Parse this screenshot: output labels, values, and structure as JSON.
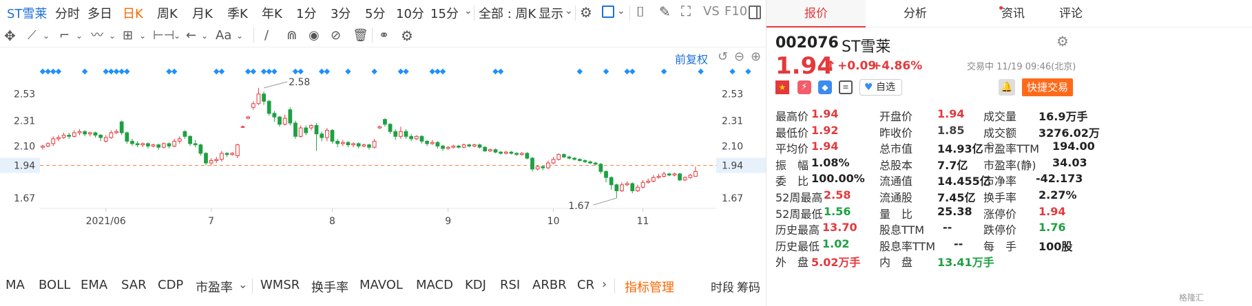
{
  "toolbar": {
    "stock_name": "ST雪莱",
    "periods": [
      "分时",
      "多日",
      "日K",
      "周K",
      "月K",
      "季K",
      "年K",
      "1分",
      "3分",
      "5分",
      "10分",
      "15分"
    ],
    "active_period": "日K",
    "all_select": "全部 : 周K",
    "display_select": "显示",
    "vs_label": "VS",
    "f10_label": "F10"
  },
  "drawing_tools": [
    "move-icon",
    "line-icon",
    "polyline-icon",
    "wave-icon",
    "fib-icon",
    "range-icon",
    "arrow-icon",
    "text-icon",
    "pen-icon",
    "magnet-icon",
    "eye-icon",
    "hide-icon",
    "trash-icon",
    "link-icon",
    "gear-icon"
  ],
  "chart_header": {
    "adjust_label": "前复权"
  },
  "chart_data": {
    "type": "candlestick",
    "y_ticks": [
      2.53,
      2.31,
      2.1,
      1.94,
      1.67
    ],
    "y_tick_labels": [
      "2.53",
      "2.31",
      "2.10",
      "1.94",
      "1.67"
    ],
    "current_price_label": "1.94",
    "ylim": [
      1.5,
      2.75
    ],
    "x_tick_labels": [
      {
        "label": "2021/06",
        "at": 12
      },
      {
        "label": "7",
        "at": 32
      },
      {
        "label": "8",
        "at": 55
      },
      {
        "label": "9",
        "at": 77
      },
      {
        "label": "10",
        "at": 97
      },
      {
        "label": "11",
        "at": 114
      }
    ],
    "annotations": [
      {
        "label": "2.58",
        "at": 42,
        "value": 2.58
      },
      {
        "label": "1.67",
        "at": 109,
        "value": 1.67
      }
    ],
    "reference_line": 1.94,
    "marker_color": "#1e90ff",
    "up_color": "#e4393c",
    "down_color": "#1ea042",
    "candles": [
      [
        2.09,
        2.1,
        2.11,
        2.07
      ],
      [
        2.1,
        2.12,
        2.13,
        2.09
      ],
      [
        2.12,
        2.16,
        2.18,
        2.1
      ],
      [
        2.16,
        2.17,
        2.19,
        2.14
      ],
      [
        2.17,
        2.19,
        2.21,
        2.16
      ],
      [
        2.19,
        2.18,
        2.21,
        2.16
      ],
      [
        2.18,
        2.21,
        2.23,
        2.17
      ],
      [
        2.21,
        2.22,
        2.24,
        2.19
      ],
      [
        2.22,
        2.2,
        2.23,
        2.18
      ],
      [
        2.2,
        2.21,
        2.22,
        2.18
      ],
      [
        2.21,
        2.19,
        2.22,
        2.17
      ],
      [
        2.19,
        2.17,
        2.2,
        2.14
      ],
      [
        2.14,
        2.17,
        2.19,
        2.13
      ],
      [
        2.17,
        2.21,
        2.23,
        2.16
      ],
      [
        2.21,
        2.22,
        2.24,
        2.2
      ],
      [
        2.3,
        2.21,
        2.31,
        2.19
      ],
      [
        2.21,
        2.14,
        2.22,
        2.12
      ],
      [
        2.14,
        2.12,
        2.16,
        2.1
      ],
      [
        2.12,
        2.11,
        2.14,
        2.09
      ],
      [
        2.11,
        2.12,
        2.13,
        2.09
      ],
      [
        2.12,
        2.1,
        2.13,
        2.08
      ],
      [
        2.1,
        2.11,
        2.12,
        2.09
      ],
      [
        2.11,
        2.09,
        2.12,
        2.07
      ],
      [
        2.09,
        2.12,
        2.13,
        2.08
      ],
      [
        2.12,
        2.1,
        2.13,
        2.08
      ],
      [
        2.1,
        2.14,
        2.16,
        2.09
      ],
      [
        2.14,
        2.16,
        2.18,
        2.12
      ],
      [
        2.22,
        2.18,
        2.23,
        2.16
      ],
      [
        2.18,
        2.12,
        2.19,
        2.1
      ],
      [
        2.12,
        2.11,
        2.15,
        2.09
      ],
      [
        2.11,
        2.04,
        2.12,
        2.02
      ],
      [
        2.04,
        1.96,
        2.05,
        1.94
      ],
      [
        1.96,
        1.98,
        2.0,
        1.94
      ],
      [
        1.98,
        1.99,
        2.01,
        1.96
      ],
      [
        1.99,
        2.04,
        2.06,
        1.97
      ],
      [
        2.04,
        2.03,
        2.05,
        2.01
      ],
      [
        2.03,
        2.04,
        2.05,
        2.02
      ],
      [
        2.02,
        2.11,
        2.12,
        2.0
      ],
      [
        2.26,
        2.26,
        2.27,
        2.25
      ],
      [
        2.33,
        2.34,
        2.35,
        2.32
      ],
      [
        2.42,
        2.45,
        2.47,
        2.4
      ],
      [
        2.45,
        2.53,
        2.58,
        2.44
      ],
      [
        2.53,
        2.47,
        2.55,
        2.44
      ],
      [
        2.47,
        2.37,
        2.48,
        2.35
      ],
      [
        2.37,
        2.34,
        2.39,
        2.3
      ],
      [
        2.34,
        2.28,
        2.35,
        2.26
      ],
      [
        2.28,
        2.33,
        2.36,
        2.27
      ],
      [
        2.4,
        2.29,
        2.42,
        2.27
      ],
      [
        2.29,
        2.18,
        2.31,
        2.16
      ],
      [
        2.18,
        2.25,
        2.27,
        2.17
      ],
      [
        2.25,
        2.21,
        2.27,
        2.19
      ],
      [
        2.25,
        2.27,
        2.28,
        2.23
      ],
      [
        2.27,
        2.2,
        2.29,
        2.06
      ],
      [
        2.2,
        2.17,
        2.22,
        2.14
      ],
      [
        2.17,
        2.23,
        2.25,
        2.14
      ],
      [
        2.23,
        2.14,
        2.24,
        2.12
      ],
      [
        2.14,
        2.12,
        2.16,
        2.09
      ],
      [
        2.12,
        2.13,
        2.15,
        2.1
      ],
      [
        2.13,
        2.11,
        2.14,
        2.09
      ],
      [
        2.11,
        2.12,
        2.13,
        2.09
      ],
      [
        2.12,
        2.1,
        2.13,
        2.08
      ],
      [
        2.1,
        2.11,
        2.12,
        2.09
      ],
      [
        2.11,
        2.09,
        2.12,
        2.07
      ],
      [
        2.09,
        2.14,
        2.16,
        2.08
      ],
      [
        2.25,
        2.26,
        2.27,
        2.24
      ],
      [
        2.32,
        2.28,
        2.33,
        2.26
      ],
      [
        2.28,
        2.22,
        2.29,
        2.2
      ],
      [
        2.22,
        2.18,
        2.24,
        2.15
      ],
      [
        2.18,
        2.22,
        2.26,
        2.16
      ],
      [
        2.22,
        2.18,
        2.24,
        2.16
      ],
      [
        2.18,
        2.16,
        2.2,
        2.14
      ],
      [
        2.16,
        2.18,
        2.19,
        2.15
      ],
      [
        2.18,
        2.14,
        2.19,
        2.12
      ],
      [
        2.14,
        2.12,
        2.15,
        2.1
      ],
      [
        2.12,
        2.13,
        2.15,
        2.11
      ],
      [
        2.13,
        2.1,
        2.14,
        2.08
      ],
      [
        2.1,
        2.08,
        2.11,
        2.06
      ],
      [
        2.08,
        2.09,
        2.1,
        2.07
      ],
      [
        2.09,
        2.1,
        2.11,
        2.08
      ],
      [
        2.1,
        2.09,
        2.11,
        2.08
      ],
      [
        2.09,
        2.11,
        2.12,
        2.08
      ],
      [
        2.11,
        2.1,
        2.12,
        2.09
      ],
      [
        2.1,
        2.11,
        2.12,
        2.09
      ],
      [
        2.11,
        2.09,
        2.12,
        2.08
      ],
      [
        2.09,
        2.06,
        2.1,
        2.05
      ],
      [
        2.06,
        2.07,
        2.08,
        2.05
      ],
      [
        2.07,
        2.05,
        2.08,
        2.04
      ],
      [
        2.05,
        2.04,
        2.06,
        2.03
      ],
      [
        2.04,
        2.05,
        2.06,
        2.03
      ],
      [
        2.05,
        2.04,
        2.06,
        2.03
      ],
      [
        2.04,
        2.03,
        2.05,
        2.02
      ],
      [
        2.03,
        2.04,
        2.05,
        2.02
      ],
      [
        2.04,
        2.0,
        2.05,
        1.99
      ],
      [
        2.0,
        1.91,
        2.01,
        1.89
      ],
      [
        1.91,
        1.93,
        1.94,
        1.9
      ],
      [
        1.93,
        1.92,
        1.94,
        1.9
      ],
      [
        1.92,
        1.96,
        1.98,
        1.91
      ],
      [
        1.96,
        1.99,
        2.01,
        1.95
      ],
      [
        1.99,
        2.03,
        2.04,
        1.98
      ],
      [
        2.03,
        2.01,
        2.04,
        2.0
      ],
      [
        2.01,
        2.0,
        2.02,
        1.99
      ],
      [
        2.0,
        1.99,
        2.01,
        1.98
      ],
      [
        1.99,
        1.98,
        2.0,
        1.97
      ],
      [
        1.98,
        1.97,
        1.99,
        1.96
      ],
      [
        1.97,
        1.96,
        1.98,
        1.95
      ],
      [
        1.96,
        1.95,
        1.97,
        1.94
      ],
      [
        1.95,
        1.89,
        1.96,
        1.87
      ],
      [
        1.89,
        1.84,
        1.9,
        1.8
      ],
      [
        1.84,
        1.78,
        1.85,
        1.74
      ],
      [
        1.78,
        1.73,
        1.79,
        1.67
      ],
      [
        1.73,
        1.78,
        1.8,
        1.72
      ],
      [
        1.78,
        1.79,
        1.81,
        1.77
      ],
      [
        1.79,
        1.73,
        1.8,
        1.71
      ],
      [
        1.73,
        1.76,
        1.78,
        1.72
      ],
      [
        1.76,
        1.8,
        1.82,
        1.75
      ],
      [
        1.8,
        1.81,
        1.83,
        1.79
      ],
      [
        1.81,
        1.84,
        1.86,
        1.8
      ],
      [
        1.84,
        1.85,
        1.87,
        1.83
      ],
      [
        1.85,
        1.87,
        1.89,
        1.84
      ],
      [
        1.87,
        1.86,
        1.88,
        1.85
      ],
      [
        1.86,
        1.87,
        1.88,
        1.85
      ],
      [
        1.87,
        1.82,
        1.88,
        1.81
      ],
      [
        1.82,
        1.84,
        1.85,
        1.81
      ],
      [
        1.84,
        1.86,
        1.87,
        1.83
      ],
      [
        1.85,
        1.89,
        1.93,
        1.85
      ]
    ],
    "marker_groups": [
      [
        0,
        1,
        2,
        3
      ],
      [
        8
      ],
      [
        12,
        13,
        14,
        15,
        16
      ],
      [
        24,
        25
      ],
      [
        33,
        34
      ],
      [
        39,
        40
      ],
      [
        42,
        43,
        44
      ],
      [
        48,
        49
      ],
      [
        53,
        54
      ],
      [
        58
      ],
      [
        63
      ],
      [
        68,
        69
      ],
      [
        74,
        75,
        76
      ],
      [
        86,
        87
      ],
      [
        102
      ],
      [
        107
      ],
      [
        111,
        112
      ],
      [
        118
      ],
      [
        125
      ],
      [
        131
      ],
      [
        134
      ],
      [
        140,
        141,
        142
      ]
    ]
  },
  "indicators": [
    "MA",
    "BOLL",
    "EMA",
    "SAR",
    "CDP",
    "市盈率",
    "WMSR",
    "换手率",
    "MAVOL",
    "MACD",
    "KDJ",
    "RSI",
    "ARBR",
    "CR"
  ],
  "indicator_manage": "指标管理",
  "bottom_right": [
    "时段",
    "筹码"
  ],
  "right_tabs": [
    "报价",
    "分析",
    "资讯",
    "评论"
  ],
  "active_tab": "报价",
  "quote": {
    "code": "002076",
    "name": "ST雪莱",
    "price": "1.94",
    "change": "+0.09",
    "change_pct": "+4.86%",
    "status_time": "交易中 11/19 09:46(北京)",
    "watch_label": "自选",
    "quick_trade": "快捷交易"
  },
  "fields": [
    {
      "k": "最高价",
      "v": "1.94",
      "c": "red"
    },
    {
      "k": "开盘价",
      "v": "1.94",
      "c": "red"
    },
    {
      "k": "成交量",
      "v": "16.9万手",
      "c": "dark"
    },
    {
      "k": "最低价",
      "v": "1.92",
      "c": "red"
    },
    {
      "k": "昨收价",
      "v": "1.85",
      "c": "gray"
    },
    {
      "k": "成交额",
      "v": "3276.02万",
      "c": "dark"
    },
    {
      "k": "平均价",
      "v": "1.94",
      "c": "red"
    },
    {
      "k": "总市值",
      "v": "14.93亿",
      "c": "dark"
    },
    {
      "k": "市盈率TTM",
      "v": "194.00",
      "c": "dark"
    },
    {
      "k": "振　幅",
      "v": "1.08%",
      "c": "dark"
    },
    {
      "k": "总股本",
      "v": "7.7亿",
      "c": "dark"
    },
    {
      "k": "市盈率(静)",
      "v": "34.03",
      "c": "dark"
    },
    {
      "k": "委　比",
      "v": "100.00%",
      "c": "dark"
    },
    {
      "k": "流通值",
      "v": "14.455亿",
      "c": "dark"
    },
    {
      "k": "市净率",
      "v": "-42.173",
      "c": "dark"
    },
    {
      "k": "52周最高",
      "v": "2.58",
      "c": "red"
    },
    {
      "k": "流通股",
      "v": "7.45亿",
      "c": "dark"
    },
    {
      "k": "换手率",
      "v": "2.27%",
      "c": "dark"
    },
    {
      "k": "52周最低",
      "v": "1.56",
      "c": "green"
    },
    {
      "k": "量　比",
      "v": "25.38",
      "c": "dark"
    },
    {
      "k": "涨停价",
      "v": "1.94",
      "c": "red"
    },
    {
      "k": "历史最高",
      "v": "13.70",
      "c": "red"
    },
    {
      "k": "股息TTM",
      "v": "--",
      "c": "dark"
    },
    {
      "k": "跌停价",
      "v": "1.76",
      "c": "green"
    },
    {
      "k": "历史最低",
      "v": "1.02",
      "c": "green"
    },
    {
      "k": "股息率TTM",
      "v": "--",
      "c": "dark"
    },
    {
      "k": "每　手",
      "v": "100股",
      "c": "dark"
    },
    {
      "k": "外　盘",
      "v": "5.02万手",
      "c": "red"
    },
    {
      "k": "内　盘",
      "v": "13.41万手",
      "c": "green"
    }
  ],
  "watermark": "格隆汇"
}
